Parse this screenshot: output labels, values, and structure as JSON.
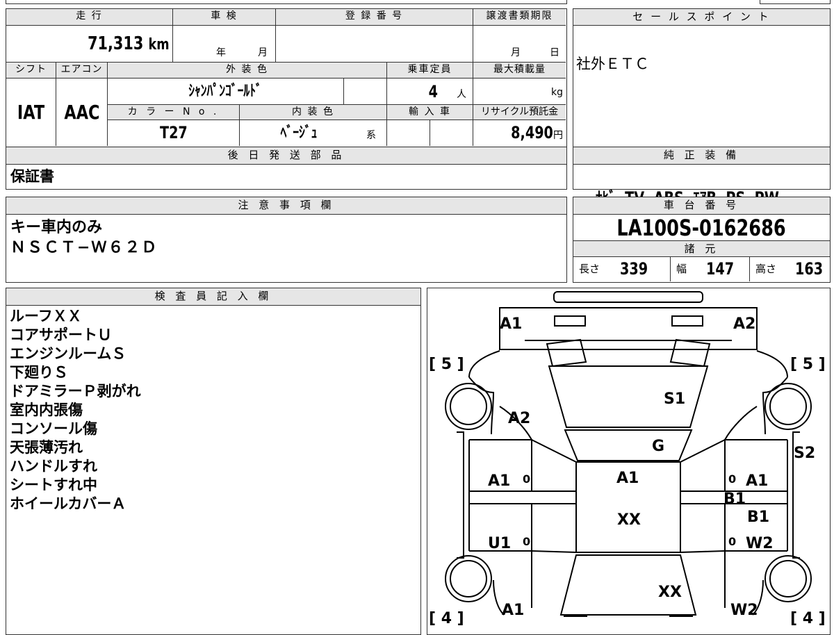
{
  "mileage": {
    "label": "走 行",
    "value": "71,313",
    "unit": "km"
  },
  "inspection": {
    "label": "車 検",
    "year": "年",
    "month": "月"
  },
  "registration": {
    "label": "登 録 番 号"
  },
  "transfer": {
    "label": "譲渡書類期限",
    "month": "月",
    "day": "日"
  },
  "shift": {
    "label": "シフト",
    "value": "IAT"
  },
  "aircon": {
    "label": "エアコン",
    "value": "AAC"
  },
  "exterior": {
    "label": "外 装 色",
    "value": "ｼｬﾝﾊﾟﾝｺﾞｰﾙﾄﾞ"
  },
  "capacity": {
    "label": "乗車定員",
    "value": "4",
    "unit": "人"
  },
  "load": {
    "label": "最大積載量",
    "unit": "kg"
  },
  "color_no": {
    "label": "カ ラ ー N o .",
    "value": "T27"
  },
  "interior": {
    "label": "内 装 色",
    "value": "ﾍﾞｰｼﾞｭ",
    "suffix": "系"
  },
  "import": {
    "label": "輸 入 車"
  },
  "recycle": {
    "label": "リサイクル預託金",
    "value": "8,490",
    "unit": "円"
  },
  "later_parts": {
    "label": "後 日 発 送 部 品",
    "value": "保証書"
  },
  "sales_point": {
    "label": "セ ー ル ス ポ イ ン ト",
    "value": "社外ＥＴＣ"
  },
  "equipment": {
    "label": "純 正 装 備",
    "value": "ﾅﾋﾞ  TV  ABS  ｴｱB  PS  PW"
  },
  "notes": {
    "label": "注 意 事 項 欄",
    "lines": [
      "キー車内のみ",
      "ＮＳＣＴ−Ｗ６２Ｄ"
    ]
  },
  "chassis": {
    "label": "車 台 番 号",
    "value": "LA100S-0162686"
  },
  "specs": {
    "label": "諸 元",
    "length_label": "長さ",
    "length": "339",
    "width_label": "幅",
    "width": "147",
    "height_label": "高さ",
    "height": "163"
  },
  "inspector": {
    "label": "検 査 員 記 入 欄",
    "lines": [
      "ルーフＸＸ",
      "コアサポートＵ",
      "エンジンルームＳ",
      "下廻りＳ",
      "ドアミラーＰ剥がれ",
      "室内内張傷",
      "コンソール傷",
      "天張薄汚れ",
      "ハンドルすれ",
      "シートすれ中",
      "ホイールカバーＡ"
    ]
  },
  "diagram": {
    "marks": {
      "front_left": "A1",
      "front_right": "A2",
      "fender_left": "A2",
      "hood": "S1",
      "windshield": "G",
      "rear_fender_right": "S2",
      "door_fl": "A1",
      "door_fr": "A1",
      "roof_front": "A1",
      "roof": "XX",
      "sill_right": "B1",
      "door_rr": "B1",
      "door_rl": "U1",
      "door_rr_lower": "W2",
      "rear_glass": "XX",
      "rear_left": "A1",
      "rear_right": "W2"
    },
    "tires": {
      "front_left": "[ 5 ]",
      "front_right": "[ 5 ]",
      "rear_left": "[ 4 ]",
      "rear_right": "[ 4 ]"
    },
    "small_marks": [
      "0",
      "0",
      "0",
      "0"
    ]
  }
}
